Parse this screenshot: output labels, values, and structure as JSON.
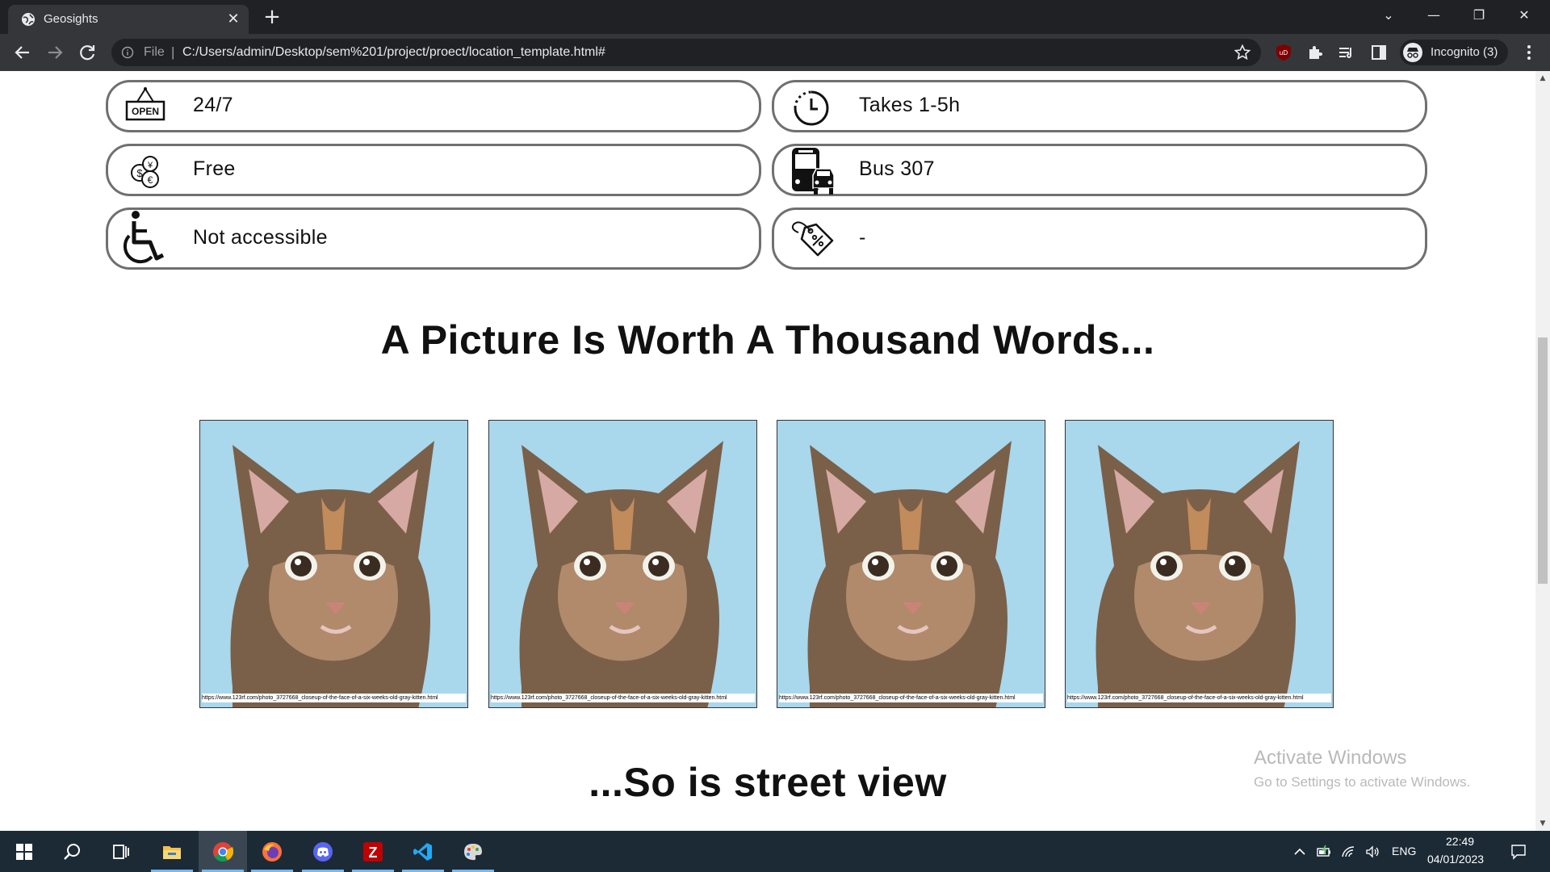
{
  "browser": {
    "tab_title": "Geosights",
    "close_glyph": "✕",
    "new_tab_glyph": "+",
    "omnibox_scheme": "File",
    "omnibox_separator": "|",
    "url": "C:/Users/admin/Desktop/sem%201/project/proect/location_template.html#",
    "incognito_label": "Incognito (3)",
    "window_controls": {
      "tablist": "⌄",
      "minimize": "—",
      "restore": "❐",
      "close": "✕"
    }
  },
  "info": {
    "hours": {
      "icon": "open-sign-icon",
      "text": "24/7"
    },
    "duration": {
      "icon": "clock-icon",
      "text": "Takes 1-5h"
    },
    "price": {
      "icon": "coins-icon",
      "text": "Free"
    },
    "transport": {
      "icon": "bus-car-icon",
      "text": "Bus 307"
    },
    "accessibility": {
      "icon": "wheelchair-icon",
      "text": "Not accessible"
    },
    "discount": {
      "icon": "price-tag-icon",
      "text": "-"
    }
  },
  "gallery": {
    "title": "A Picture Is Worth A Thousand Words...",
    "photos": [
      {
        "credit": "https://www.123rf.com/photo_3727668_closeup-of-the-face-of-a-six-weeks-old-gray-kitten.html"
      },
      {
        "credit": "https://www.123rf.com/photo_3727668_closeup-of-the-face-of-a-six-weeks-old-gray-kitten.html"
      },
      {
        "credit": "https://www.123rf.com/photo_3727668_closeup-of-the-face-of-a-six-weeks-old-gray-kitten.html"
      },
      {
        "credit": "https://www.123rf.com/photo_3727668_closeup-of-the-face-of-a-six-weeks-old-gray-kitten.html"
      }
    ]
  },
  "street_view": {
    "title": "...So is street view"
  },
  "windows_watermark": {
    "title": "Activate Windows",
    "subtitle": "Go to Settings to activate Windows."
  },
  "taskbar": {
    "language": "ENG",
    "time": "22:49",
    "date": "04/01/2023"
  },
  "colors": {
    "tab_bar": "#202124",
    "toolbar": "#35363a",
    "pill_border": "#707070",
    "taskbar": "#1c2a36",
    "photo_background": "#a9d7ec"
  }
}
